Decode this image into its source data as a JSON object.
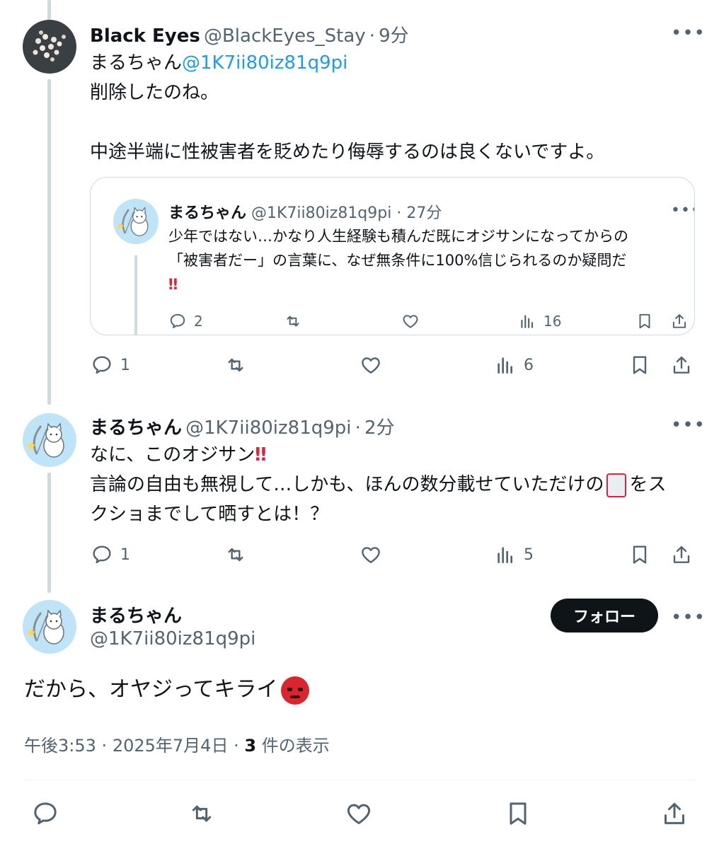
{
  "post1": {
    "name": "Black Eyes",
    "handle": "@BlackEyes_Stay",
    "time": "9分",
    "mention_name": "まるちゃん",
    "mention_handle": "@1K7ii80iz81q9pi",
    "line1": "削除したのね。",
    "line2": "中途半端に性被害者を貶めたり侮辱するのは良くないですよ。",
    "replies": "1",
    "views": "6"
  },
  "quote": {
    "name": "まるちゃん",
    "handle": "@1K7ii80iz81q9pi",
    "time": "27分",
    "line1": "少年ではない…かなり人生経験も積んだ既にオジサンになってからの",
    "line2": "「被害者だー」の言葉に、なぜ無条件に100%信じられるのか疑問だ",
    "excl": "‼",
    "replies": "2",
    "views": "16"
  },
  "post2": {
    "name": "まるちゃん",
    "handle": "@1K7ii80iz81q9pi",
    "time": "2分",
    "line1": "なに、このオジサン",
    "excl": "‼",
    "line2a": "言論の自由も無視して…しかも、ほんの数分載せていただけの",
    "line2b": "をス",
    "line3": "クショまでして晒すとは！？",
    "replies": "1",
    "views": "5"
  },
  "post3": {
    "name": "まるちゃん",
    "handle": "@1K7ii80iz81q9pi",
    "follow_label": "フォロー",
    "text": "だから、オヤジってキライ",
    "time": "午後3:53",
    "date": "2025年7月4日",
    "views_count": "3",
    "views_label": "件の表示"
  },
  "icons": [
    "reply-icon",
    "retweet-icon",
    "like-icon",
    "views-icon",
    "bookmark-icon",
    "share-icon",
    "more-icon",
    "angry-face-icon"
  ],
  "colors": {
    "link": "#1d9bf0",
    "text": "#0f1419",
    "muted": "#536471",
    "border": "#cfd9de",
    "excl": "#d7263d"
  }
}
